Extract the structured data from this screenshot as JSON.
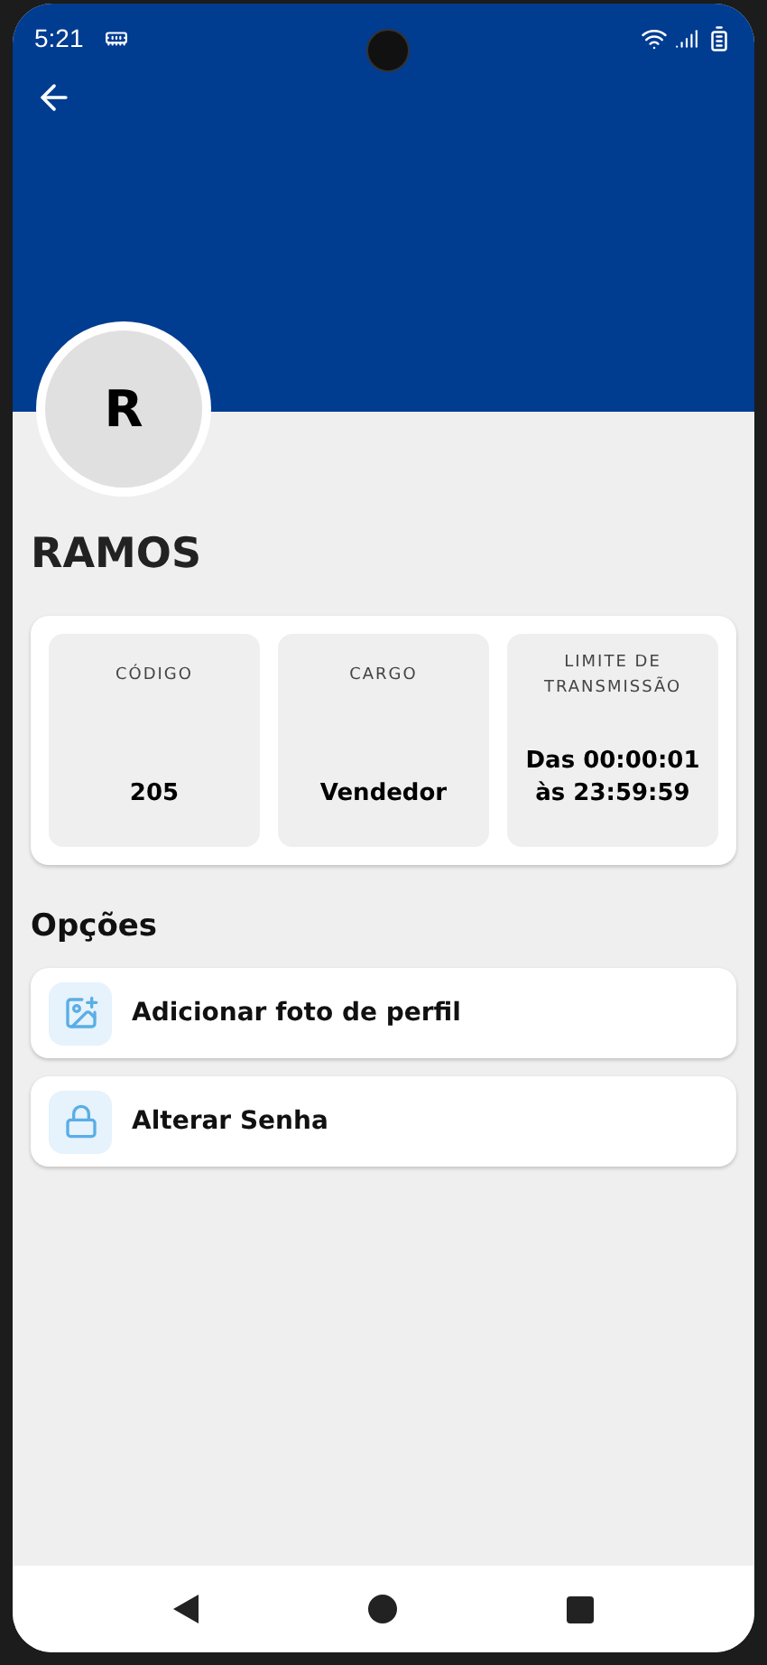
{
  "status_bar": {
    "time": "5:21"
  },
  "profile": {
    "initial": "R",
    "name": "RAMOS"
  },
  "info_cards": [
    {
      "label": "CÓDIGO",
      "value": "205"
    },
    {
      "label": "CARGO",
      "value": "Vendedor"
    },
    {
      "label": "LIMITE DE TRANSMISSÃO",
      "value": "Das 00:00:01 às 23:59:59"
    }
  ],
  "options": {
    "title": "Opções",
    "items": [
      {
        "kind": "photo",
        "label": "Adicionar foto de perfil"
      },
      {
        "kind": "lock",
        "label": "Alterar Senha"
      }
    ]
  }
}
